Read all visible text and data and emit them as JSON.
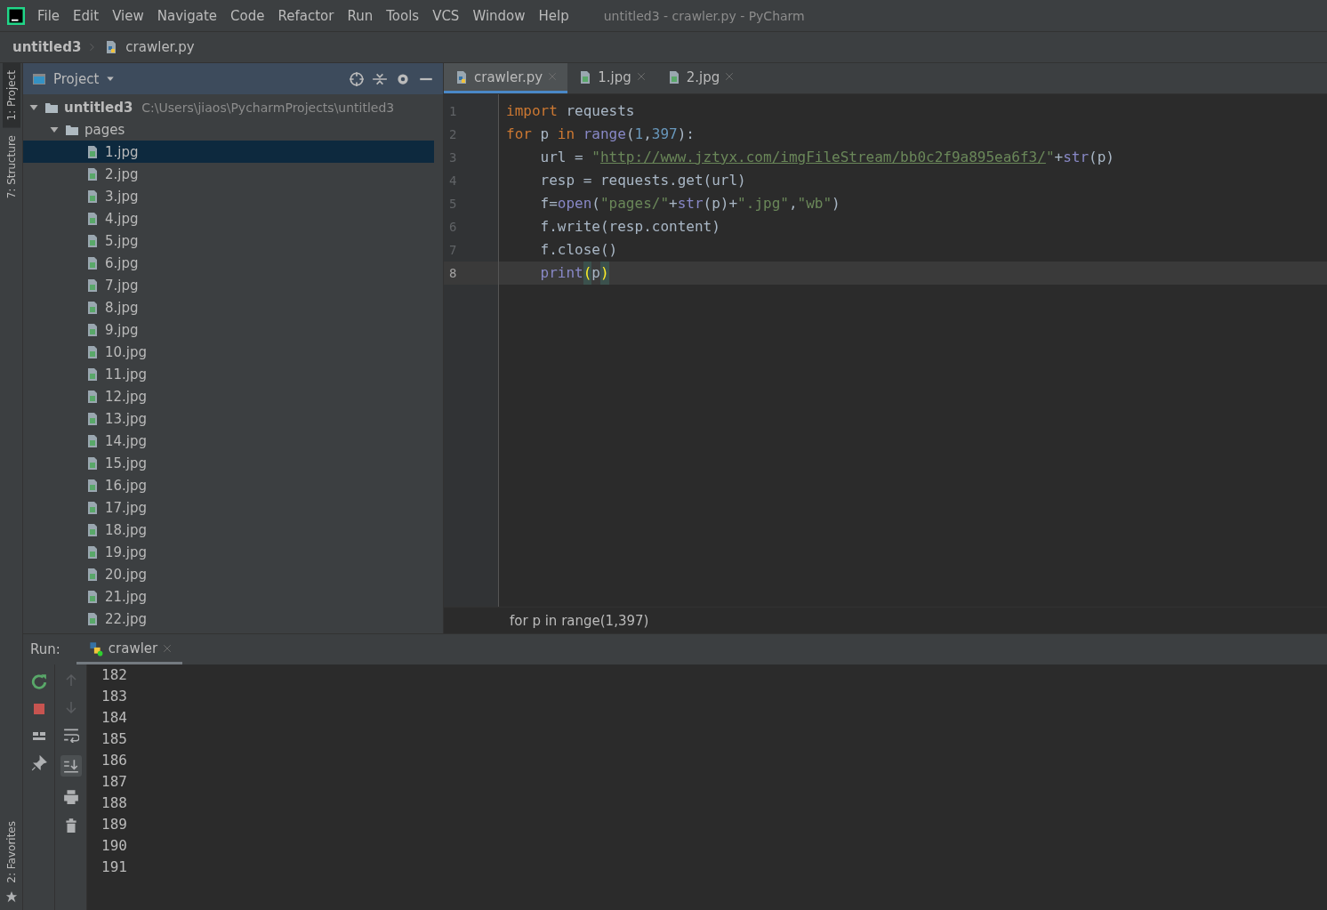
{
  "menu": [
    "File",
    "Edit",
    "View",
    "Navigate",
    "Code",
    "Refactor",
    "Run",
    "Tools",
    "VCS",
    "Window",
    "Help"
  ],
  "window": {
    "title": "untitled3 - crawler.py - PyCharm"
  },
  "breadcrumb": [
    "untitled3",
    "crawler.py"
  ],
  "side_tabs": [
    {
      "label": "1: Project",
      "selected": true
    },
    {
      "label": "7: Structure",
      "selected": false
    }
  ],
  "favorites": {
    "label": "2: Favorites"
  },
  "project": {
    "title": "Project",
    "tree": [
      {
        "name": "untitled3",
        "path": "C:\\Users\\jiaos\\PycharmProjects\\untitled3",
        "kind": "folder",
        "expanded": true,
        "selected": false,
        "children": [
          {
            "name": "pages",
            "kind": "folder",
            "expanded": true,
            "selected": false,
            "children": [
              {
                "name": "1.jpg",
                "kind": "image",
                "selected": true
              },
              {
                "name": "2.jpg",
                "kind": "image",
                "selected": false
              },
              {
                "name": "3.jpg",
                "kind": "image",
                "selected": false
              },
              {
                "name": "4.jpg",
                "kind": "image",
                "selected": false
              },
              {
                "name": "5.jpg",
                "kind": "image",
                "selected": false
              },
              {
                "name": "6.jpg",
                "kind": "image",
                "selected": false
              },
              {
                "name": "7.jpg",
                "kind": "image",
                "selected": false
              },
              {
                "name": "8.jpg",
                "kind": "image",
                "selected": false
              },
              {
                "name": "9.jpg",
                "kind": "image",
                "selected": false
              },
              {
                "name": "10.jpg",
                "kind": "image",
                "selected": false
              },
              {
                "name": "11.jpg",
                "kind": "image",
                "selected": false
              },
              {
                "name": "12.jpg",
                "kind": "image",
                "selected": false
              },
              {
                "name": "13.jpg",
                "kind": "image",
                "selected": false
              },
              {
                "name": "14.jpg",
                "kind": "image",
                "selected": false
              },
              {
                "name": "15.jpg",
                "kind": "image",
                "selected": false
              },
              {
                "name": "16.jpg",
                "kind": "image",
                "selected": false
              },
              {
                "name": "17.jpg",
                "kind": "image",
                "selected": false
              },
              {
                "name": "18.jpg",
                "kind": "image",
                "selected": false
              },
              {
                "name": "19.jpg",
                "kind": "image",
                "selected": false
              },
              {
                "name": "20.jpg",
                "kind": "image",
                "selected": false
              },
              {
                "name": "21.jpg",
                "kind": "image",
                "selected": false
              },
              {
                "name": "22.jpg",
                "kind": "image",
                "selected": false
              }
            ]
          }
        ]
      }
    ]
  },
  "editor_tabs": [
    {
      "label": "crawler.py",
      "kind": "python",
      "selected": true
    },
    {
      "label": "1.jpg",
      "kind": "image",
      "selected": false
    },
    {
      "label": "2.jpg",
      "kind": "image",
      "selected": false
    }
  ],
  "code": [
    {
      "number": "1",
      "current": false,
      "tokens": [
        {
          "kind": "kw",
          "text": "import"
        },
        {
          "kind": "plain",
          "text": " requests"
        }
      ]
    },
    {
      "number": "2",
      "current": false,
      "tokens": [
        {
          "kind": "kw",
          "text": "for"
        },
        {
          "kind": "plain",
          "text": " p "
        },
        {
          "kind": "kw",
          "text": "in"
        },
        {
          "kind": "builtin",
          "text": " range"
        },
        {
          "kind": "plain",
          "text": "("
        },
        {
          "kind": "num",
          "text": "1"
        },
        {
          "kind": "plain",
          "text": ","
        },
        {
          "kind": "num",
          "text": "397"
        },
        {
          "kind": "plain",
          "text": "):"
        }
      ]
    },
    {
      "number": "3",
      "current": false,
      "tokens": [
        {
          "kind": "plain",
          "text": "    url = "
        },
        {
          "kind": "str",
          "text": "\""
        },
        {
          "kind": "url",
          "text": "http://www.jztyx.com/imgFileStream/bb0c2f9a895ea6f3/"
        },
        {
          "kind": "str",
          "text": "\""
        },
        {
          "kind": "plain",
          "text": "+"
        },
        {
          "kind": "builtin",
          "text": "str"
        },
        {
          "kind": "plain",
          "text": "(p)"
        }
      ]
    },
    {
      "number": "4",
      "current": false,
      "tokens": [
        {
          "kind": "plain",
          "text": "    resp = requests.get(url)"
        }
      ]
    },
    {
      "number": "5",
      "current": false,
      "tokens": [
        {
          "kind": "plain",
          "text": "    f="
        },
        {
          "kind": "builtin",
          "text": "open"
        },
        {
          "kind": "plain",
          "text": "("
        },
        {
          "kind": "str",
          "text": "\"pages/\""
        },
        {
          "kind": "plain",
          "text": "+"
        },
        {
          "kind": "builtin",
          "text": "str"
        },
        {
          "kind": "plain",
          "text": "(p)+"
        },
        {
          "kind": "str",
          "text": "\".jpg\""
        },
        {
          "kind": "plain",
          "text": ","
        },
        {
          "kind": "str",
          "text": "\"wb\""
        },
        {
          "kind": "plain",
          "text": ")"
        }
      ]
    },
    {
      "number": "6",
      "current": false,
      "tokens": [
        {
          "kind": "plain",
          "text": "    f.write(resp.content)"
        }
      ]
    },
    {
      "number": "7",
      "current": false,
      "tokens": [
        {
          "kind": "plain",
          "text": "    f.close()"
        }
      ]
    },
    {
      "number": "8",
      "current": true,
      "tokens": [
        {
          "kind": "builtin",
          "text": "    print"
        },
        {
          "kind": "brace",
          "text": "("
        },
        {
          "kind": "plain",
          "text": "p"
        },
        {
          "kind": "brace",
          "text": ")"
        }
      ]
    }
  ],
  "editor_breadcrumb": "for p in range(1,397)",
  "run": {
    "label": "Run:",
    "tab": "crawler",
    "output": [
      "182",
      "183",
      "184",
      "185",
      "186",
      "187",
      "188",
      "189",
      "190",
      "191"
    ]
  }
}
